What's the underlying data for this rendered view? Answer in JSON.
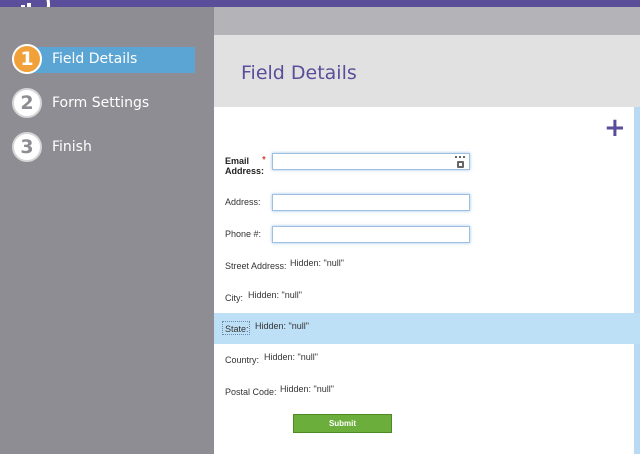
{
  "sidebar": {
    "steps": [
      {
        "number": "1",
        "label": "Field Details",
        "active": true
      },
      {
        "number": "2",
        "label": "Form Settings",
        "active": false
      },
      {
        "number": "3",
        "label": "Finish",
        "active": false
      }
    ]
  },
  "header": {
    "title": "Field Details"
  },
  "toolbar": {
    "add_icon": "plus-icon"
  },
  "form": {
    "email_label": "Email Address:",
    "required_marker": "*",
    "address_label": "Address:",
    "phone_label": "Phone #:",
    "street_label": "Street Address:",
    "street_value": "Hidden: \"null\"",
    "city_label": "City:",
    "city_value": "Hidden: \"null\"",
    "state_label": "State:",
    "state_value": "Hidden: \"null\"",
    "country_label": "Country:",
    "country_value": "Hidden: \"null\"",
    "postal_label": "Postal Code:",
    "postal_value": "Hidden: \"null\"",
    "submit_label": "Submit"
  },
  "colors": {
    "brand": "#5a4e9a",
    "active_step": "#5aa5d4",
    "step_badge": "#f0a13a",
    "submit": "#6cae3b",
    "selected_row": "#bde0f6"
  }
}
